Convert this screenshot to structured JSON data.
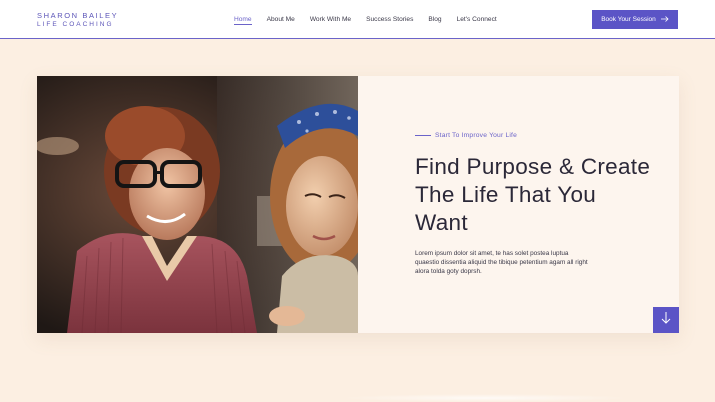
{
  "brand": {
    "name": "SHARON BAILEY",
    "subtitle": "LIFE COACHING"
  },
  "nav": {
    "items": [
      {
        "label": "Home",
        "active": true
      },
      {
        "label": "About Me",
        "active": false
      },
      {
        "label": "Work With Me",
        "active": false
      },
      {
        "label": "Success Stories",
        "active": false
      },
      {
        "label": "Blog",
        "active": false
      },
      {
        "label": "Let's Connect",
        "active": false
      }
    ]
  },
  "cta": {
    "label": "Book Your Session",
    "icon": "arrow-right-icon"
  },
  "hero": {
    "eyebrow": "Start To Improve Your Life",
    "title": "Find Purpose & Create The Life That You Want",
    "body": "Lorem ipsum dolor sit amet, te has solet postea luptua quaestio dissentia aliquid the tibique petentium agam all right alora tolda goty doprsh.",
    "image": "two-women-smiling-photo"
  },
  "scroll": {
    "icon": "arrow-down-icon"
  },
  "colors": {
    "accent": "#5b54c6",
    "page_background": "#fcefe2",
    "card_background": "#fdf5ee"
  }
}
